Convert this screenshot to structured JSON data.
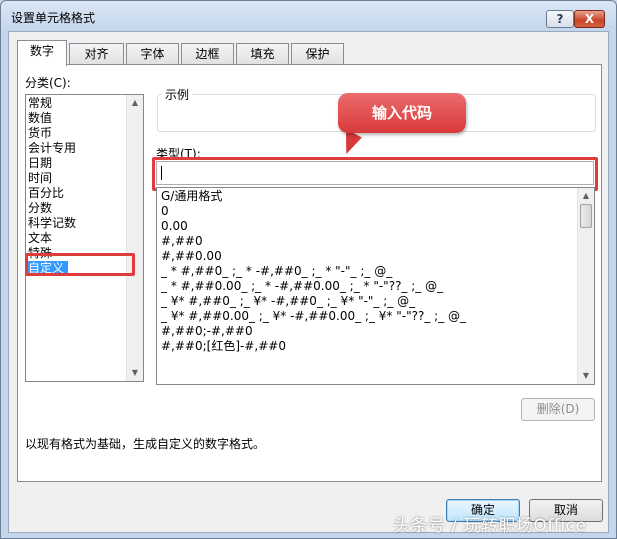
{
  "window": {
    "title": "设置单元格格式",
    "help_label": "?",
    "close_label": "X"
  },
  "tabs": [
    {
      "label": "数字",
      "active": true
    },
    {
      "label": "对齐",
      "active": false
    },
    {
      "label": "字体",
      "active": false
    },
    {
      "label": "边框",
      "active": false
    },
    {
      "label": "填充",
      "active": false
    },
    {
      "label": "保护",
      "active": false
    }
  ],
  "category": {
    "label": "分类(C):",
    "items": [
      "常规",
      "数值",
      "货币",
      "会计专用",
      "日期",
      "时间",
      "百分比",
      "分数",
      "科学记数",
      "文本",
      "特殊",
      "自定义"
    ],
    "selected": "自定义"
  },
  "sample": {
    "label": "示例",
    "value": ""
  },
  "type": {
    "label": "类型(T):",
    "value": ""
  },
  "format_list": [
    "G/通用格式",
    "0",
    "0.00",
    "#,##0",
    "#,##0.00",
    "_ * #,##0_ ;_ * -#,##0_ ;_ * \"-\"_ ;_ @_",
    "_ * #,##0.00_ ;_ * -#,##0.00_ ;_ * \"-\"??_ ;_ @_",
    "_ ¥* #,##0_ ;_ ¥* -#,##0_ ;_ ¥* \"-\"_ ;_ @_",
    "_ ¥* #,##0.00_ ;_ ¥* -#,##0.00_ ;_ ¥* \"-\"??_ ;_ @_",
    "#,##0;-#,##0",
    "#,##0;[红色]-#,##0"
  ],
  "delete_button": "删除(D)",
  "description": "以现有格式为基础，生成自定义的数字格式。",
  "ok_button": "确定",
  "cancel_button": "取消",
  "callout": "输入代码",
  "watermark": "头条号 / 玩转职场Office",
  "colors": {
    "highlight": "#e03c3c",
    "selection": "#3399ff"
  }
}
